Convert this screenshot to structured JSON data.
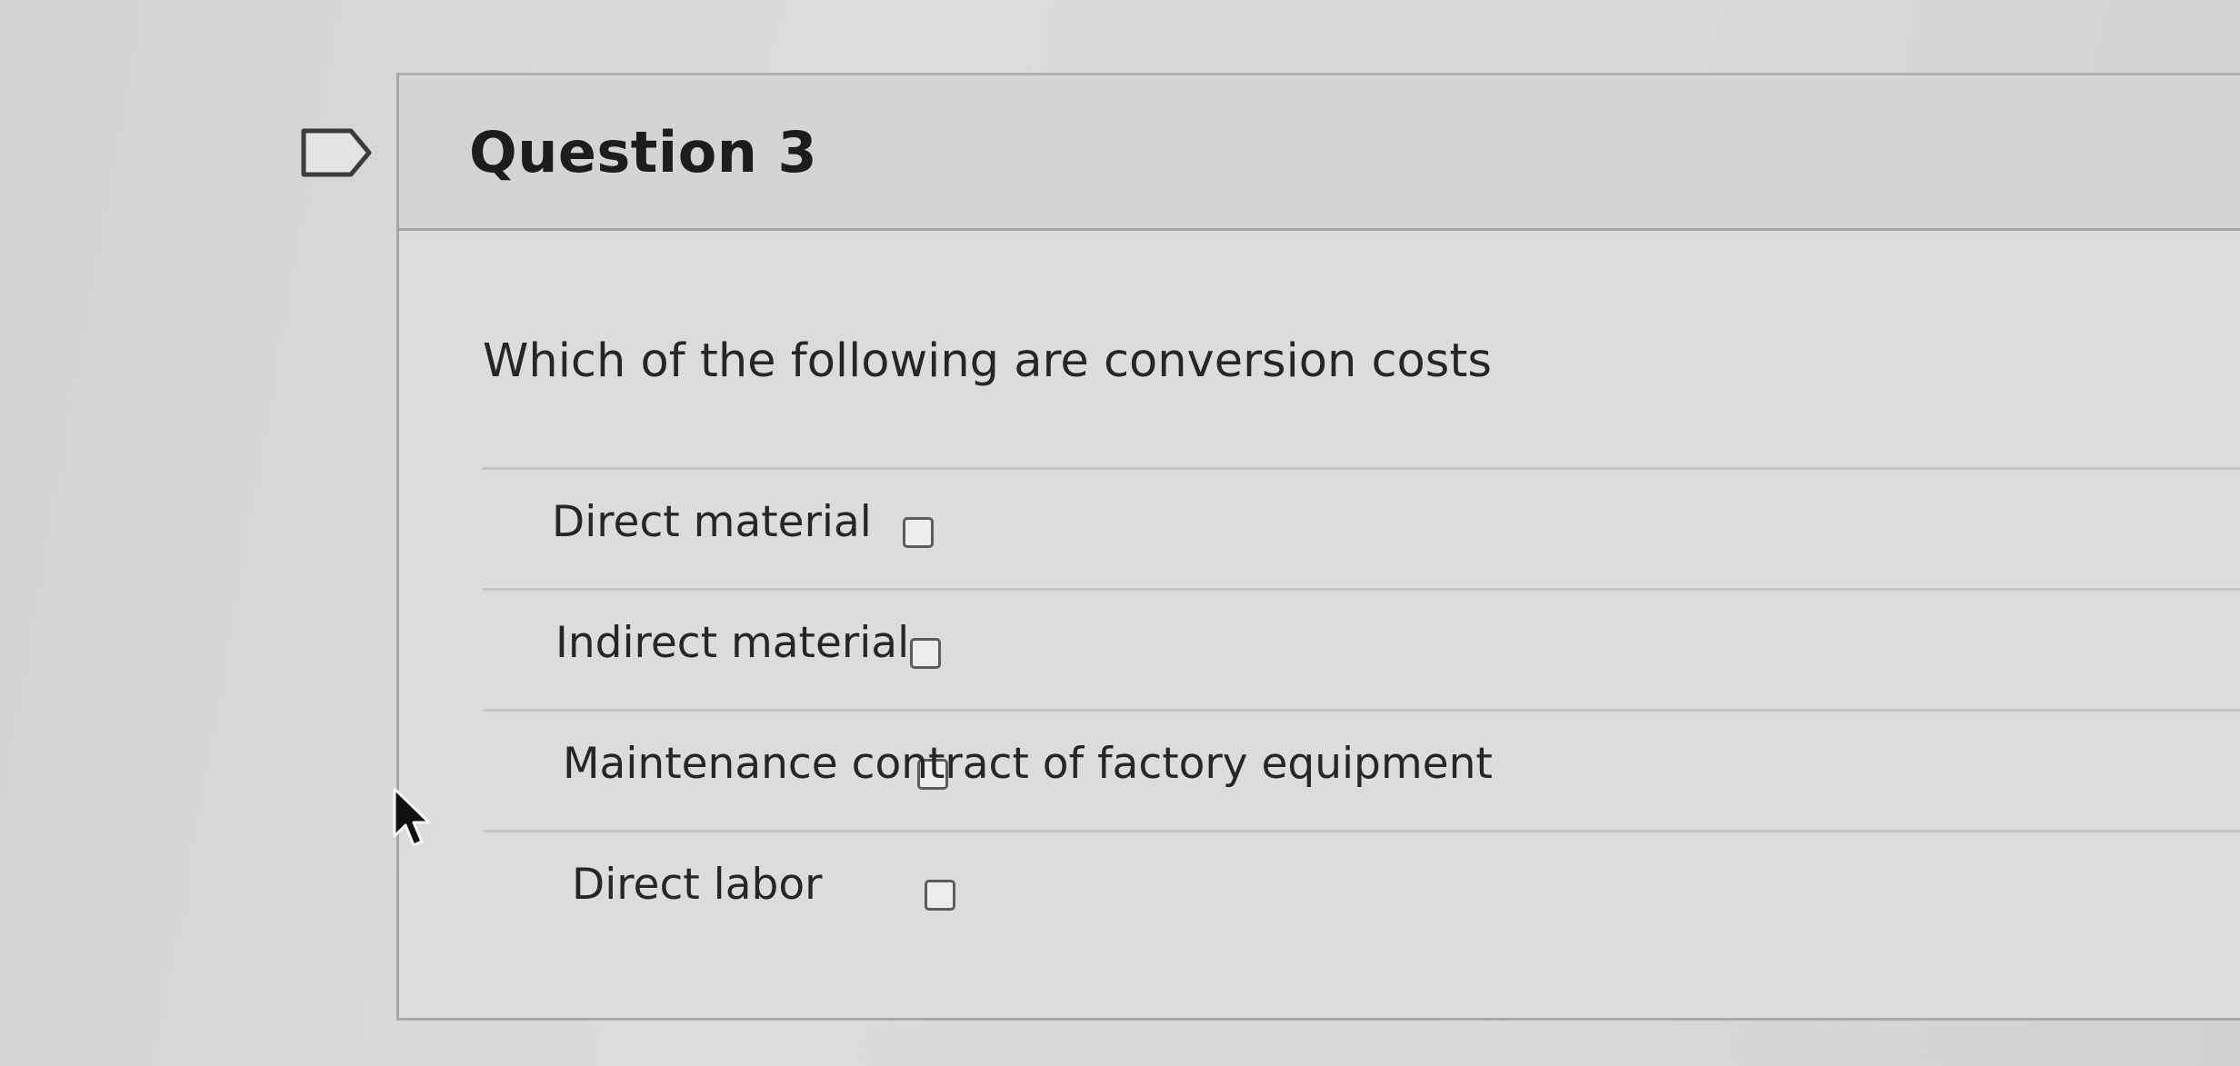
{
  "question": {
    "title": "Question 3",
    "prompt": "Which of the following are conversion costs",
    "bookmark_icon": "bookmark-flag-icon",
    "answers": [
      {
        "label": "Direct material",
        "checked": false
      },
      {
        "label": "Indirect material",
        "checked": false
      },
      {
        "label": "Maintenance contract of factory equipment",
        "checked": false
      },
      {
        "label": "Direct labor",
        "checked": false
      }
    ]
  },
  "cursor_icon": "mouse-pointer-icon"
}
